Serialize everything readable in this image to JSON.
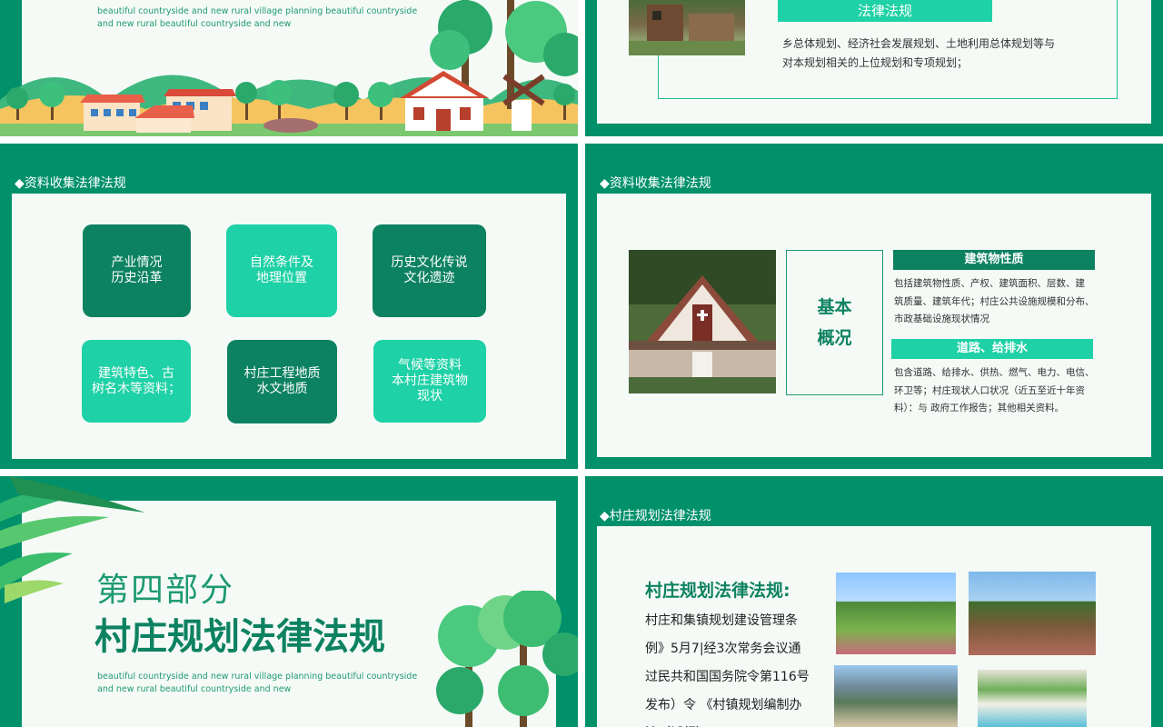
{
  "colors": {
    "brand": "#00906a",
    "accent": "#1fd1a6",
    "dark": "#0d8261",
    "panel": "#f5faf6"
  },
  "slide1": {
    "subtitle_en": "beautiful countryside and new rural village planning beautiful countryside\nand new rural beautiful countryside and new"
  },
  "slide2": {
    "banner": "法律法规",
    "text": "乡总体规划、经济社会发展规划、土地利用总体规划等与\n对本规划相关的上位规划和专项规划；"
  },
  "slide3": {
    "section_title": "◆资料收集法律法规",
    "cards": [
      "产业情况\n历史沿革",
      "自然条件及\n地理位置",
      "历史文化传说\n文化遗迹",
      "建筑特色、古\n树名木等资料；",
      "村庄工程地质\n水文地质",
      "气候等资料\n本村庄建筑物\n现状"
    ]
  },
  "slide4": {
    "section_title": "◆资料收集法律法规",
    "box_label": "基本\n概况",
    "heading1": "建筑物性质",
    "text1": "包括建筑物性质、产权、建筑面积、层数、建\n筑质量、建筑年代；村庄公共设施规模和分布、\n市政基础设施现状情况",
    "heading2": "道路、给排水",
    "text2": "包含道路、给排水、供热、燃气、电力、电信、\n环卫等；村庄现状人口状况（近五至近十年资\n料）：与 政府工作报告；其他相关资料。"
  },
  "slide5": {
    "part": "第四部分",
    "title": "村庄规划法律法规",
    "subtitle_en": "beautiful countryside and new rural village planning beautiful countryside\nand new rural beautiful countryside and new"
  },
  "slide6": {
    "section_title": "◆村庄规划法律法规",
    "heading": "村庄规划法律法规:",
    "lines": [
      "村庄和集镇规划建设管理条",
      "例》5月7|经3次常务会议通",
      "过民共和国国务院令第116号",
      "发布）令 《村镇规划编制办",
      "法（试行）"
    ]
  }
}
